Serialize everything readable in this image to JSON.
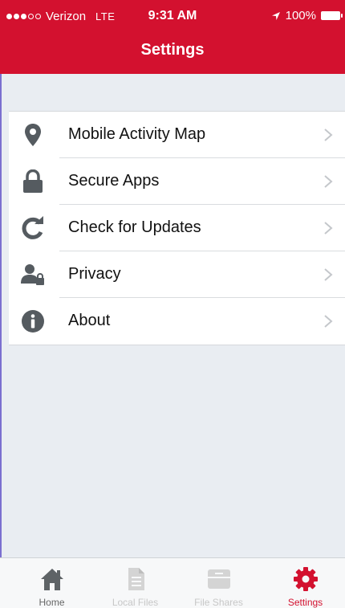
{
  "status_bar": {
    "carrier": "Verizon",
    "network": "LTE",
    "time": "9:31 AM",
    "battery": "100%",
    "signal_icon": "signal-dots-icon",
    "location_icon": "location-arrow-icon",
    "battery_icon": "battery-icon"
  },
  "header": {
    "title": "Settings",
    "color": "#d3112f"
  },
  "menu": [
    {
      "label": "Mobile Activity Map",
      "icon": "map-pin-icon"
    },
    {
      "label": "Secure Apps",
      "icon": "lock-icon"
    },
    {
      "label": "Check for Updates",
      "icon": "refresh-icon"
    },
    {
      "label": "Privacy",
      "icon": "user-lock-icon"
    },
    {
      "label": "About",
      "icon": "info-icon"
    }
  ],
  "tabbar": [
    {
      "label": "Home",
      "icon": "home-icon",
      "state": "enabled"
    },
    {
      "label": "Local Files",
      "icon": "file-icon",
      "state": "disabled"
    },
    {
      "label": "File Shares",
      "icon": "archive-icon",
      "state": "disabled"
    },
    {
      "label": "Settings",
      "icon": "gear-icon",
      "state": "active"
    }
  ]
}
